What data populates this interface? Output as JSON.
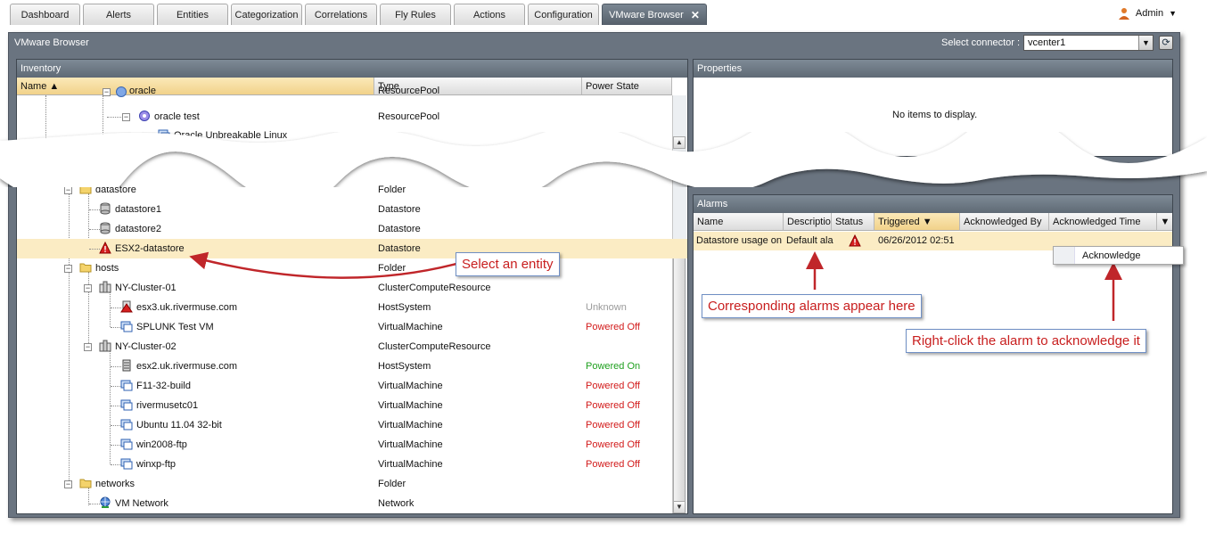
{
  "tabs": [
    {
      "label": "Dashboard"
    },
    {
      "label": "Alerts"
    },
    {
      "label": "Entities"
    },
    {
      "label": "Categorization"
    },
    {
      "label": "Correlations"
    },
    {
      "label": "Fly Rules"
    },
    {
      "label": "Actions"
    },
    {
      "label": "Configuration"
    },
    {
      "label": "VMware Browser",
      "active": true
    }
  ],
  "user": {
    "name": "Admin"
  },
  "window": {
    "title": "VMware Browser"
  },
  "connector": {
    "label": "Select connector :",
    "value": "vcenter1"
  },
  "inventory": {
    "title": "Inventory",
    "columns": {
      "name": "Name",
      "type": "Type",
      "power": "Power State"
    },
    "top_rows": [
      {
        "name": "oracle",
        "type": "ResourcePool",
        "power": ""
      },
      {
        "name": "oracle test",
        "type": "ResourcePool",
        "power": ""
      },
      {
        "name": "Oracle Unbreakable Linux",
        "type": "",
        "power": ""
      }
    ],
    "rows": [
      {
        "name": "datastore",
        "type": "Folder",
        "power": ""
      },
      {
        "name": "datastore1",
        "type": "Datastore",
        "power": ""
      },
      {
        "name": "datastore2",
        "type": "Datastore",
        "power": ""
      },
      {
        "name": "ESX2-datastore",
        "type": "Datastore",
        "power": ""
      },
      {
        "name": "hosts",
        "type": "Folder",
        "power": ""
      },
      {
        "name": "NY-Cluster-01",
        "type": "ClusterComputeResource",
        "power": ""
      },
      {
        "name": "esx3.uk.rivermuse.com",
        "type": "HostSystem",
        "power": "Unknown"
      },
      {
        "name": "SPLUNK Test VM",
        "type": "VirtualMachine",
        "power": "Powered Off"
      },
      {
        "name": "NY-Cluster-02",
        "type": "ClusterComputeResource",
        "power": ""
      },
      {
        "name": "esx2.uk.rivermuse.com",
        "type": "HostSystem",
        "power": "Powered On"
      },
      {
        "name": "F11-32-build",
        "type": "VirtualMachine",
        "power": "Powered Off"
      },
      {
        "name": "rivermusetc01",
        "type": "VirtualMachine",
        "power": "Powered Off"
      },
      {
        "name": "Ubuntu 11.04 32-bit",
        "type": "VirtualMachine",
        "power": "Powered Off"
      },
      {
        "name": "win2008-ftp",
        "type": "VirtualMachine",
        "power": "Powered Off"
      },
      {
        "name": "winxp-ftp",
        "type": "VirtualMachine",
        "power": "Powered Off"
      },
      {
        "name": "networks",
        "type": "Folder",
        "power": ""
      },
      {
        "name": "VM Network",
        "type": "Network",
        "power": ""
      }
    ]
  },
  "properties": {
    "title": "Properties",
    "empty_text": "No items to display."
  },
  "alarms": {
    "title": "Alarms",
    "columns": {
      "name": "Name",
      "description": "Descriptio",
      "status": "Status",
      "triggered": "Triggered",
      "acknowledged_by": "Acknowledged By",
      "acknowledged_time": "Acknowledged Time"
    },
    "rows": [
      {
        "name": "Datastore usage on",
        "description": "Default ala",
        "triggered": "06/26/2012 02:51",
        "acknowledged_by": "",
        "acknowledged_time": ""
      }
    ]
  },
  "context_menu": {
    "item": "Acknowledge"
  },
  "callouts": {
    "select_entity": "Select an entity",
    "alarms_appear": "Corresponding alarms appear here",
    "right_click": "Right-click the alarm to acknowledge it"
  },
  "colors": {
    "powered_off": "#d21a1a",
    "powered_on": "#1fa01f",
    "unknown": "#9a9a9a",
    "selection": "#fbecc4",
    "header_dark": "#5f6a75",
    "callout_text": "#c81e1e"
  },
  "icons": {
    "folder": "folder-icon",
    "datastore": "datastore-icon",
    "datastore_alarm": "warning-triangle-icon",
    "cluster": "cluster-icon",
    "host": "server-icon",
    "host_alarm": "server-alert-icon",
    "vm": "virtual-machine-icon",
    "network": "network-globe-icon",
    "resource_pool": "resource-pool-icon",
    "user": "user-icon",
    "refresh": "refresh-icon"
  }
}
